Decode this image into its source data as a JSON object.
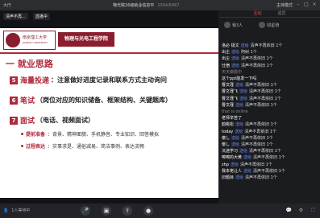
{
  "window": {
    "left_label": "大厅",
    "title": "物光院16级就业信息平",
    "room_id": "1094/6467",
    "host_label": "主持模式"
  },
  "stage": {
    "tags": [
      "清声不再...",
      "直播中"
    ]
  },
  "slide": {
    "university_cn": "南京理工大学",
    "university_en": "JIANGSU UNIVERSITY",
    "school": "物理与光电工程学院",
    "heading": "一 就业思路",
    "items": [
      {
        "num": "5",
        "key": "海量投递",
        "desc": "：注意做好进度记录和联系方式主动询问"
      },
      {
        "num": "6",
        "key": "笔试",
        "desc": "（岗位对应的知识储备、框架结构、关键题库）"
      },
      {
        "num": "7",
        "key": "面试",
        "desc": "（电话、视频面试）"
      }
    ],
    "bullets": [
      {
        "key": "提前准备",
        "text": "：背景、精神面貌、手机静音、专业知识、回答模拟"
      },
      {
        "key": "过程表达",
        "text": "：实事求是、通俗减易、简洁事例、表达流畅"
      }
    ]
  },
  "chat": {
    "tabs": [
      "互动",
      "成员"
    ],
    "active_tab": 0,
    "people": [
      "我3人",
      "财星骑"
    ],
    "messages": [
      {
        "user": "洛必 极文",
        "role": "送给",
        "text": "清声不再依旧 1个"
      },
      {
        "user": "出尘",
        "role": "送给",
        "text": "阿树 1个"
      },
      {
        "user": "出尘",
        "role": "送给",
        "text": "清声不再依旧 1个"
      },
      {
        "user": "仕宿",
        "role": "送给",
        "text": "清声不再依旧 1个"
      },
      {
        "user": "",
        "role": "",
        "text": "天天做题中",
        "sys": true
      },
      {
        "user": "这个ppt能发一下吗",
        "role": "",
        "text": ""
      },
      {
        "user": "曹文瑾",
        "role": "送给",
        "text": "清声不再依旧 1个"
      },
      {
        "user": "曹文瑾飞",
        "role": "送给",
        "text": "清声不再依旧 1个"
      },
      {
        "user": "曹文瑾飞",
        "role": "送给",
        "text": "清声不再依旧 1个"
      },
      {
        "user": "曹文瑾",
        "role": "送给",
        "text": "清声不再依旧 1个"
      },
      {
        "user": "",
        "role": "",
        "text": "that is online",
        "sys": true
      },
      {
        "user": "老师辛苦了",
        "role": "",
        "text": ""
      },
      {
        "user": "韵桃松",
        "role": "送给",
        "text": "清声不再依旧 1个"
      },
      {
        "user": "today",
        "role": "送给",
        "text": "清声不再依旧 1个"
      },
      {
        "user": "傻し",
        "role": "送给",
        "text": "清声不再依旧 1个"
      },
      {
        "user": "傻し",
        "role": "送给",
        "text": "清声不再依旧 1个"
      },
      {
        "user": "沉迷学习",
        "role": "送给",
        "text": "清声不再依旧 1个"
      },
      {
        "user": "嚓嚓的大黄",
        "role": "送给",
        "text": "清声不再依旧 1个"
      },
      {
        "user": "zhp",
        "role": "送给",
        "text": "清声不再依旧 1个"
      },
      {
        "user": "我本佬让人",
        "role": "送给",
        "text": "清声不再依旧 1个"
      },
      {
        "user": "旧题目",
        "role": "送给",
        "text": "清声不再依旧 1个"
      }
    ]
  },
  "bottom": {
    "attendee_label": "1人等待中",
    "controls": [
      "mic-icon",
      "camera-icon",
      "share-icon",
      "record-icon"
    ],
    "right_icons": [
      "chat-icon",
      "settings-icon",
      "fullscreen-icon"
    ]
  },
  "colors": {
    "accent": "#b0283c",
    "chat_role": "#6a8cff",
    "active_tab": "#e05050"
  }
}
